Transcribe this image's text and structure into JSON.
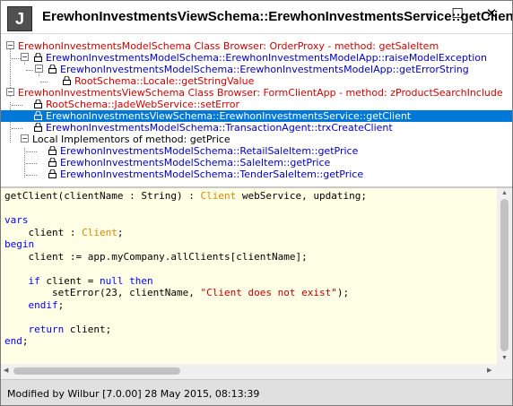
{
  "window": {
    "icon_letter": "J",
    "title": "ErewhonInvestmentsViewSchema::ErewhonInvestmentsService::getClient",
    "controls": {
      "minimize": "–",
      "maximize": "☐",
      "close": "✕"
    }
  },
  "tree": {
    "nodes": [
      {
        "label": "ErewhonInvestmentsModelSchema Class Browser: OrderProxy - method: getSaleItem",
        "color": "red"
      },
      {
        "label": "ErewhonInvestmentsModelSchema::ErewhonInvestmentsModelApp::raiseModelException",
        "color": "blue"
      },
      {
        "label": "ErewhonInvestmentsModelSchema::ErewhonInvestmentsModelApp::getErrorString",
        "color": "blue"
      },
      {
        "label": "RootSchema::Locale::getStringValue",
        "color": "red"
      },
      {
        "label": "ErewhonInvestmentsViewSchema Class Browser: FormClientApp - method: zProductSearchInclude",
        "color": "red"
      },
      {
        "label": "RootSchema::JadeWebService::setError",
        "color": "red"
      },
      {
        "label": "ErewhonInvestmentsViewSchema::ErewhonInvestmentsService::getClient",
        "color": "selected"
      },
      {
        "label": "ErewhonInvestmentsModelSchema::TransactionAgent::trxCreateClient",
        "color": "blue"
      },
      {
        "label": "Local Implementors of method: getPrice",
        "color": "black"
      },
      {
        "label": "ErewhonInvestmentsModelSchema::RetailSaleItem::getPrice",
        "color": "blue"
      },
      {
        "label": "ErewhonInvestmentsModelSchema::SaleItem::getPrice",
        "color": "blue"
      },
      {
        "label": "ErewhonInvestmentsModelSchema::TenderSaleItem::getPrice",
        "color": "blue"
      }
    ]
  },
  "code": {
    "lines": [
      "getClient(clientName : String) : Client webService, updating;",
      "",
      "vars",
      "    client : Client;",
      "begin",
      "    client := app.myCompany.allClients[clientName];",
      "",
      "    if client = null then",
      "        setError(23, clientName, \"Client does not exist\");",
      "    endif;",
      "",
      "    return client;",
      "end;"
    ],
    "colors": {
      "keyword": "#0000ff",
      "class": "#d88a00",
      "string": "#c00000",
      "background": "#ffffe5"
    }
  },
  "status": {
    "text": "Modified by Wilbur [7.0.00] 28 May 2015, 08:13:39"
  },
  "colors": {
    "selection": "#0078d7",
    "red_node": "#d00000",
    "blue_node": "#0000c0"
  }
}
